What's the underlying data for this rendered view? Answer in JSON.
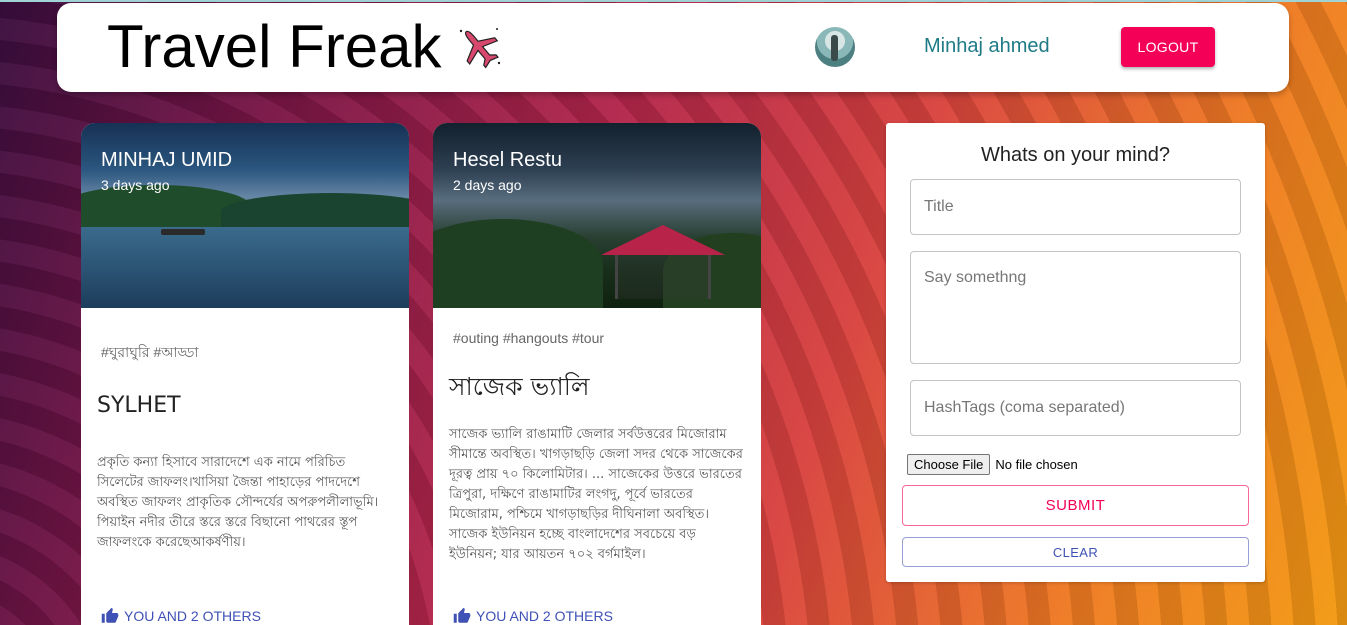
{
  "navbar": {
    "title": "Travel Freak",
    "user_name": "Minhaj ahmed",
    "logout_label": "LOGOUT"
  },
  "posts": [
    {
      "author": "MINHAJ UMID",
      "time": "3 days ago",
      "tags": "#ঘুরাঘুরি #আড্ডা",
      "title": "SYLHET",
      "message": "প্রকৃতি কন্যা হিসাবে সারাদেশে এক নামে পরিচিত সিলেটের জাফলং।খাসিয়া জৈন্তা পাহাড়ের পাদদেশে অবস্থিত জাফলং প্রাকৃতিক সৌন্দর্যের অপরুপলীলাভূমি। পিয়াইন নদীর তীরে স্তরে স্তরে বিছানো পাথরের স্তূপ জাফলংকে করেছেআকর্ষণীয়।",
      "likes": "YOU AND 2 OTHERS"
    },
    {
      "author": "Hesel Restu",
      "time": "2 days ago",
      "tags": "#outing #hangouts #tour",
      "title": "সাজেক ভ্যালি",
      "message": "সাজেক ভ্যালি রাঙামাটি জেলার সর্বউত্তরের মিজোরাম সীমান্তে অবস্থিত। খাগড়াছড়ি জেলা সদর থেকে সাজেকের দূরত্ব প্রায় ৭০ কিলোমিটার। ... সাজেকের উত্তরে ভারতের ত্রিপুরা, দক্ষিণে রাঙামাটির লংগদু, পূর্বে ভারতের মিজোরাম, পশ্চিমে খাগড়াছড়ির দীঘিনালা অবস্থিত। সাজেক ইউনিয়ন হচ্ছে বাংলাদেশের সবচেয়ে বড় ইউনিয়ন; যার আয়তন ৭০২ বর্গমাইল।",
      "likes": "YOU AND 2 OTHERS"
    }
  ],
  "form": {
    "heading": "Whats on your mind?",
    "title_placeholder": "Title",
    "message_placeholder": "Say somethng",
    "tags_placeholder": "HashTags (coma separated)",
    "file_button": "Choose File",
    "file_status": "No file chosen",
    "submit_label": "SUBMIT",
    "clear_label": "CLEAR"
  },
  "colors": {
    "accent_pink": "#f50057",
    "accent_blue": "#3f51b5",
    "username_teal": "#1e7b86"
  },
  "icons": {
    "plane": "airplane-icon",
    "like": "thumb-up-icon"
  }
}
